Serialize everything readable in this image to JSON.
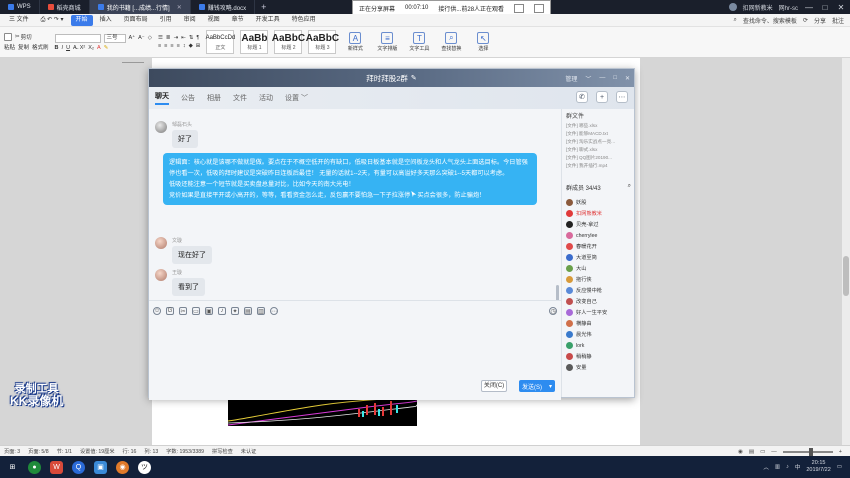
{
  "titlebar": {
    "tabs": [
      {
        "label": "WPS",
        "color": "#3b7bea",
        "active": false
      },
      {
        "label": "稻壳商城",
        "color": "#e94d3c",
        "active": false
      },
      {
        "label": "我的书籍 [...成绩...行情]",
        "color": "#3b7bea",
        "active": true
      },
      {
        "label": "赚钱攻略.docx",
        "color": "#3b7bea",
        "active": false
      }
    ],
    "share_banner": {
      "status": "正在分享屏幕",
      "time": "00:07:10",
      "viewers": "接行供...前28人正在观看"
    },
    "right": {
      "account": "扣网新教米",
      "role": "网hr-sc"
    }
  },
  "menubar": {
    "items": [
      "三 文件",
      "开始",
      "插入",
      "页面布局",
      "引用",
      "审阅",
      "视图",
      "章节",
      "开发工具",
      "特色应用"
    ],
    "active_index": 1,
    "search": "查找命令、搜索模板",
    "share": "分享",
    "comment": "批注"
  },
  "ribbon": {
    "clipboard": [
      "粘贴",
      "剪切",
      "复制",
      "格式刷"
    ],
    "font_size": "三号",
    "styles": [
      {
        "preview": "AaBbCcDd",
        "name": "正文"
      },
      {
        "preview": "AaBb",
        "name": "标题 1"
      },
      {
        "preview": "AaBbC",
        "name": "标题 2"
      },
      {
        "preview": "AaBbC",
        "name": "标题 3"
      }
    ],
    "tools": [
      {
        "label": "新样式",
        "icon": "A"
      },
      {
        "label": "文字排版",
        "icon": "≡"
      },
      {
        "label": "查找替换",
        "icon": "⌕"
      },
      {
        "label": "选择",
        "icon": "↖"
      },
      {
        "label": "文字工具",
        "icon": "T"
      }
    ]
  },
  "chat": {
    "title": "拜时拜股2群",
    "head_right": [
      "管理",
      "﹀",
      "—",
      "□",
      "✕"
    ],
    "tabs": [
      "聊天",
      "公告",
      "相册",
      "文件",
      "活动",
      "设置 ﹀"
    ],
    "messages": [
      {
        "name": "邹磊石头",
        "text": "好了"
      },
      {
        "name": "文璇",
        "text": "现在好了"
      },
      {
        "name": "王璇",
        "text": "看到了"
      }
    ],
    "big_message": {
      "line1": "逻辑面：核心就是该哪不做就是做。要点在于不概空低开的有缺口，低吸日板基本就是空间板龙头和人气龙头上面选目标。今日管强停也看一次，低吸的拜时建议是突破昨日连板后最佳！ 无量的话就1--2天，有量可以高溢好多天那么突破1--5天都可以考虑。",
      "line2": "低吸还能注意一个短节就是买卖盘总量对比，比如今天的南大光电！",
      "line3_a": "竞价如果是直接平开或小高开的，等等，看看资金怎么走，反包赢不要怕急一下子拉涨停",
      "line3_b": "买点会很多，防止骗炮！"
    },
    "close_button": "关闭(C)",
    "send_button": "发送(S)",
    "files": {
      "title": "群文件",
      "items": [
        "[文件] 哪些.xlsx",
        "[文件] 能够MACD.txt",
        "[文件] 淘乐实战点一亮...",
        "[文件] 聊式.xlsx",
        "[文件] QQ图片20190...",
        "[文件] 我开插行.mp4"
      ]
    },
    "members_title": "群成员 34/43",
    "members": [
      {
        "name": "妖股",
        "red": false,
        "color": "#8b5a3c"
      },
      {
        "name": "扣网熊教米",
        "red": true,
        "color": "#e03a3a"
      },
      {
        "name": "贝壳-拿过",
        "red": false,
        "color": "#222"
      },
      {
        "name": "cherrylee",
        "red": false,
        "color": "#d86a9c"
      },
      {
        "name": "春暖花开",
        "red": false,
        "color": "#e04a4a"
      },
      {
        "name": "大道至简",
        "red": false,
        "color": "#3a6ccc"
      },
      {
        "name": "大山",
        "red": false,
        "color": "#6aa04a"
      },
      {
        "name": "拖行侠",
        "red": false,
        "color": "#d89a3a"
      },
      {
        "name": "反应慢中枪",
        "red": false,
        "color": "#5a8ad8"
      },
      {
        "name": "改变自己",
        "red": false,
        "color": "#c05050"
      },
      {
        "name": "好人一生平安",
        "red": false,
        "color": "#a86ad8"
      },
      {
        "name": "横静由",
        "red": false,
        "color": "#d0704a"
      },
      {
        "name": "晨光伟",
        "red": false,
        "color": "#3a7acc"
      },
      {
        "name": "lork",
        "red": false,
        "color": "#3aa06a"
      },
      {
        "name": "稍稍静",
        "red": false,
        "color": "#c84a4a"
      },
      {
        "name": "安量",
        "red": false,
        "color": "#5a5a5a"
      }
    ]
  },
  "watermark": {
    "line1": "录制工具",
    "line2": "KK录像机"
  },
  "statusbar": {
    "items": [
      "页面: 3",
      "页面: 5/8",
      "节: 1/1",
      "设置值: 19厘米",
      "行: 16",
      "列: 13",
      "字数: 1953/3389",
      "拼写检查",
      "未认证"
    ]
  },
  "taskbar": {
    "time": "20:15",
    "date": "2019/7/22"
  }
}
